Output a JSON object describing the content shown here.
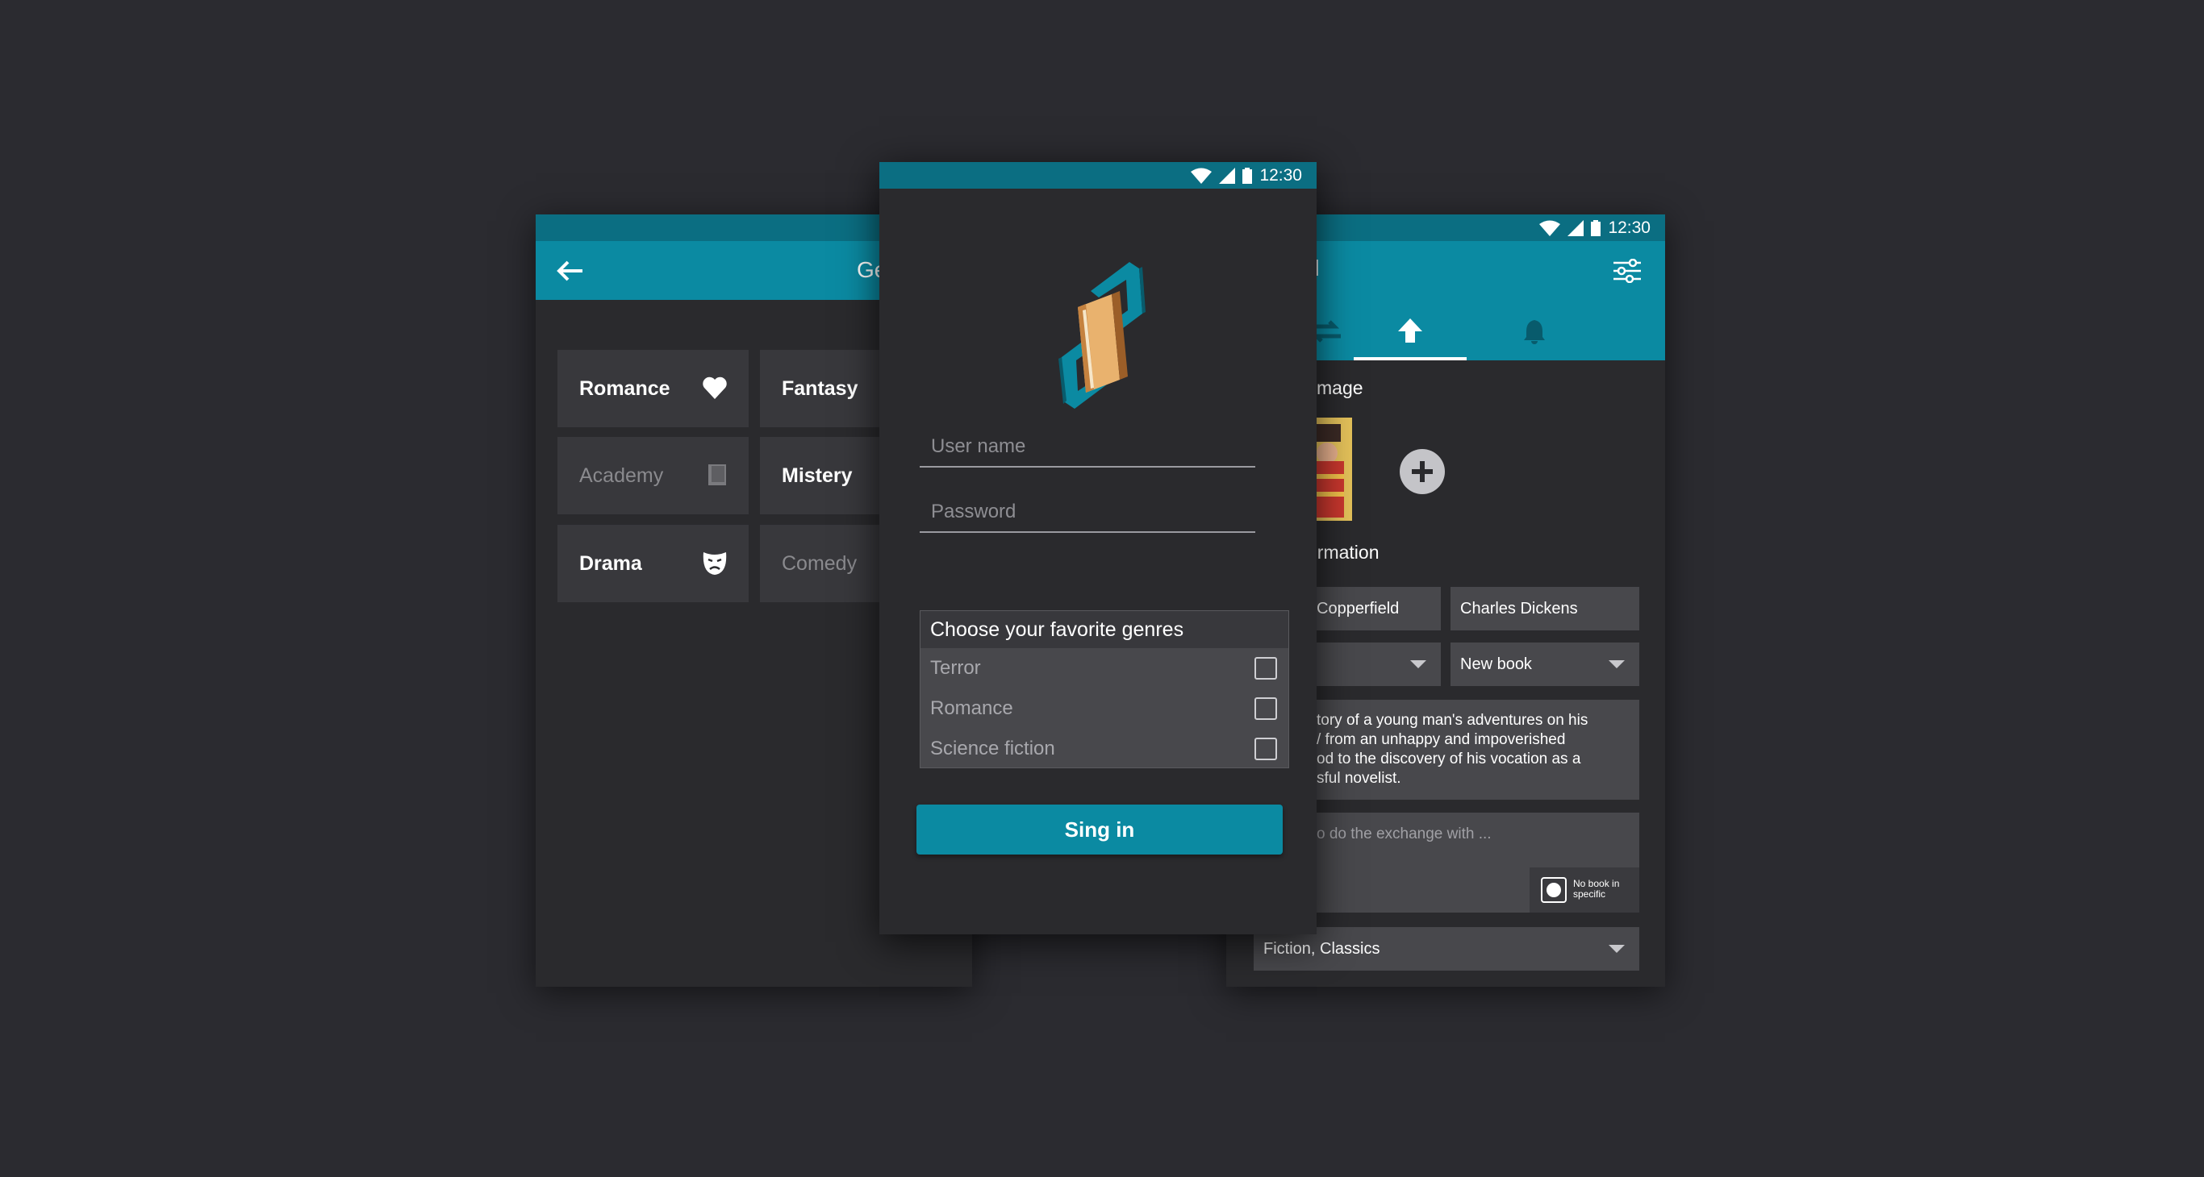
{
  "status": {
    "time": "12:30"
  },
  "genres_screen": {
    "title": "Ge",
    "tiles": [
      {
        "label": "Romance",
        "icon": "heart-icon",
        "active": true
      },
      {
        "label": "Fantasy",
        "icon": "",
        "active": true
      },
      {
        "label": "Academy",
        "icon": "book-icon",
        "active": false
      },
      {
        "label": "Mistery",
        "icon": "",
        "active": true
      },
      {
        "label": "Drama",
        "icon": "mask-icon",
        "active": true
      },
      {
        "label": "Comedy",
        "icon": "",
        "active": false
      }
    ]
  },
  "login_screen": {
    "username_placeholder": "User name",
    "password_placeholder": "Password",
    "genres_header": "Choose your favorite genres",
    "genres": [
      "Terror",
      "Romance",
      "Science fiction"
    ],
    "signin_label": "Sing in",
    "colors": {
      "accent": "#0b8aa2",
      "statusbar": "#0b6e82",
      "background": "#2a2a2d"
    }
  },
  "add_book_screen": {
    "title_partial": "d",
    "tabs": [
      "swap-icon",
      "upload-icon",
      "bell-icon"
    ],
    "image_section": "mage",
    "info_section": "ormation",
    "book_title": "Copperfield",
    "author": "Charles Dickens",
    "condition": "New book",
    "description": "tory of a young man's adventures on his\n/ from an unhappy and impoverished\nod to the discovery of his vocation as a\nsful novelist.",
    "exchange_placeholder": "o do the exchange with ...",
    "no_book_label": "No book in\nspecific",
    "categories": "Fiction, Classics"
  }
}
